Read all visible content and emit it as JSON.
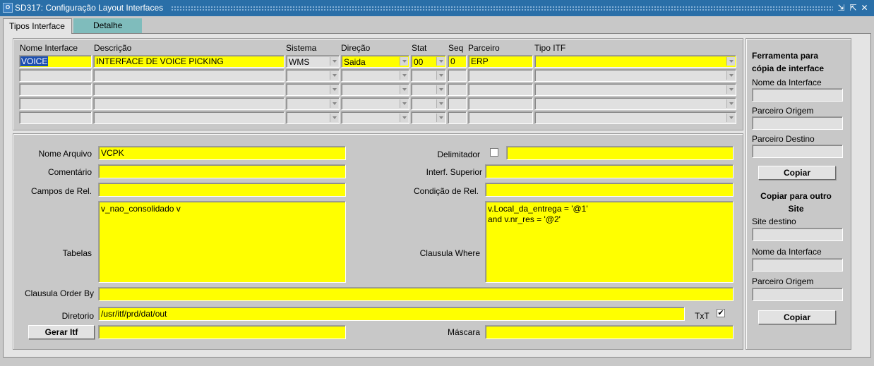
{
  "window": {
    "title": "SD317: Configuração Layout Interfaces",
    "icon_text": "O",
    "min_icon": "⇲",
    "max_icon": "⇱",
    "close_icon": "✕"
  },
  "tabs": [
    {
      "label": "Tipos Interface",
      "active": true
    },
    {
      "label": "Detalhe",
      "active": false
    }
  ],
  "grid": {
    "headers": {
      "nome": "Nome Interface",
      "descricao": "Descrição",
      "sistema": "Sistema",
      "direcao": "Direção",
      "stat": "Stat",
      "seq": "Seq",
      "parceiro": "Parceiro",
      "tipo_itf": "Tipo ITF"
    },
    "rows": [
      {
        "nome": "VOICE",
        "descricao": "INTERFACE DE VOICE PICKING",
        "sistema": "WMS",
        "direcao": "Saida",
        "stat": "00",
        "seq": "0",
        "parceiro": "ERP",
        "tipo_itf": ""
      },
      {
        "nome": "",
        "descricao": "",
        "sistema": "",
        "direcao": "",
        "stat": "",
        "seq": "",
        "parceiro": "",
        "tipo_itf": ""
      },
      {
        "nome": "",
        "descricao": "",
        "sistema": "",
        "direcao": "",
        "stat": "",
        "seq": "",
        "parceiro": "",
        "tipo_itf": ""
      },
      {
        "nome": "",
        "descricao": "",
        "sistema": "",
        "direcao": "",
        "stat": "",
        "seq": "",
        "parceiro": "",
        "tipo_itf": ""
      },
      {
        "nome": "",
        "descricao": "",
        "sistema": "",
        "direcao": "",
        "stat": "",
        "seq": "",
        "parceiro": "",
        "tipo_itf": ""
      }
    ]
  },
  "detail": {
    "nome_arquivo": {
      "label": "Nome Arquivo",
      "value": "VCPK"
    },
    "comentario": {
      "label": "Comentário",
      "value": ""
    },
    "campos_rel": {
      "label": "Campos de Rel.",
      "value": ""
    },
    "tabelas": {
      "label": "Tabelas",
      "value": "v_nao_consolidado v"
    },
    "clausula_order": {
      "label": "Clausula Order By",
      "value": ""
    },
    "diretorio": {
      "label": "Diretorio",
      "value": "/usr/itf/prd/dat/out"
    },
    "gerar_itf": {
      "label": "Gerar Itf"
    },
    "gerar_value": "",
    "delimitador": {
      "label": "Delimitador",
      "checked": false,
      "value": ""
    },
    "interf_superior": {
      "label": "Interf. Superior",
      "value": ""
    },
    "condicao_rel": {
      "label": "Condição de Rel.",
      "value": ""
    },
    "clausula_where": {
      "label": "Clausula Where",
      "value": "v.Local_da_entrega = '@1'\nand v.nr_res = '@2'"
    },
    "txt": {
      "label": "TxT",
      "checked": true,
      "mark": "✔"
    },
    "mascara": {
      "label": "Máscara",
      "value": ""
    }
  },
  "tool": {
    "title": "Ferramenta para cópia de interface",
    "nome_label": "Nome da Interface",
    "nome_value": "",
    "origem_label": "Parceiro Origem",
    "origem_value": "",
    "destino_label": "Parceiro Destino",
    "destino_value": "",
    "copiar_label": "Copiar",
    "site_title": "Copiar para outro Site",
    "site_label": "Site destino",
    "site_value": "",
    "nome2_label": "Nome da Interface",
    "nome2_value": "",
    "origem2_label": "Parceiro Origem",
    "origem2_value": "",
    "copiar2_label": "Copiar"
  }
}
